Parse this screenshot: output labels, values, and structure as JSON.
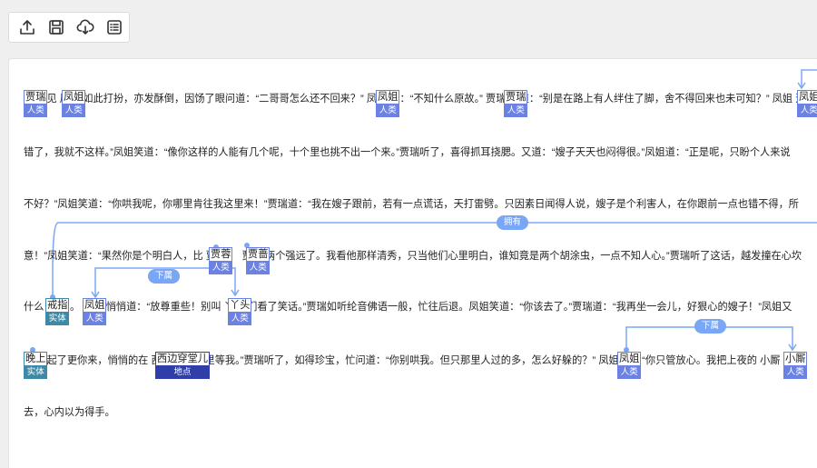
{
  "toolbar": {
    "buttons": [
      {
        "name": "upload-icon"
      },
      {
        "name": "save-icon"
      },
      {
        "name": "cloud-download-icon"
      },
      {
        "name": "list-icon"
      }
    ]
  },
  "colors": {
    "person": "#6b82e3",
    "thing": "#3e8aa6",
    "place": "#2f3ea8",
    "relation": "#7aa7f5"
  },
  "lines": [
    "贾瑞 见 凤姐 如此打扮，亦发酥倒，因饧了眼问道：“二哥哥怎么还不回来？” 凤姐 道：“不知什么原故。” 贾瑞 笑道：“别是在路上有人绊住了脚，舍不得回来也未可知？” 凤姐 道",
    "错了，我就不这样。”凤姐笑道：“像你这样的人能有几个呢，十个里也挑不出一个来。”贾瑞听了，喜得抓耳挠腮。又道：“嫂子天天也闷得很。”凤姐道：“正是呢，只盼个人来说",
    "不好？”凤姐笑道：“你哄我呢，你哪里肯往我这里来！”贾瑞道：“我在嫂子跟前，若有一点谎话，天打雷劈。只因素日闻得人说，嫂子是个利害人，在你跟前一点也错不得，所",
    "意！”凤姐笑道：“果然你是个明白人，比 贾蓉 、 贾蔷 两个强远了。我看他那样清秀，只当他们心里明白，谁知竟是两个胡涂虫，一点不知人心。”贾瑞听了这话，越发撞在心坎",
    "什么 戒指 。 凤姐 悄悄道：“放尊重些！别叫 丫头 们看了笑话。”贾瑞如听纶音佛语一般，忙往后退。凤姐笑道：“你该去了。”贾瑞道：“我再坐一会儿，好狠心的嫂子！”凤姐又",
    "晚上 起了更你来，悄悄的在 西边穿堂儿 里等我。”贾瑞听了，如得珍宝，忙问道：“你别哄我。但只那里人过的多，怎么好躲的？” 凤姐 道：“你只管放心。我把上夜的 小厮 们",
    "去，心内以为得手。"
  ],
  "entities": [
    {
      "text": "贾瑞",
      "type": "人类"
    },
    {
      "text": "凤姐",
      "type": "人类"
    },
    {
      "text": "凤姐",
      "type": "人类"
    },
    {
      "text": "贾瑞",
      "type": "人类"
    },
    {
      "text": "凤姐",
      "type": "人类"
    },
    {
      "text": "贾蓉",
      "type": "人类"
    },
    {
      "text": "贾蔷",
      "type": "人类"
    },
    {
      "text": "戒指",
      "type": "实体"
    },
    {
      "text": "凤姐",
      "type": "人类"
    },
    {
      "text": "丫头",
      "type": "人类"
    },
    {
      "text": "晚上",
      "type": "实体"
    },
    {
      "text": "西边穿堂儿",
      "type": "地点"
    },
    {
      "text": "凤姐",
      "type": "人类"
    },
    {
      "text": "小厮",
      "type": "人类"
    }
  ],
  "relations": [
    {
      "label": "拥有"
    },
    {
      "label": "下属"
    },
    {
      "label": "下属"
    }
  ]
}
